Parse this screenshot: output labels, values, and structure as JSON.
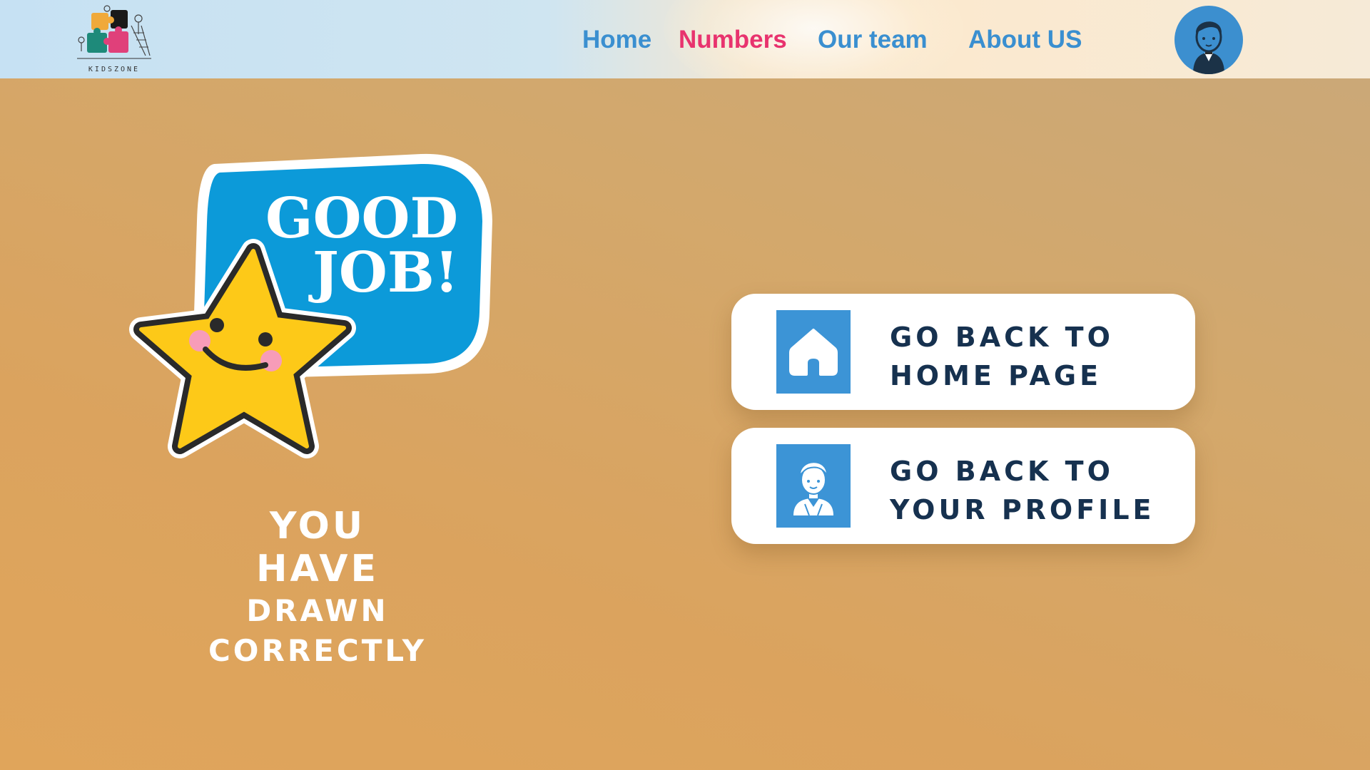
{
  "header": {
    "logo_text": "KIDSZONE",
    "nav": [
      {
        "label": "Home",
        "active": false
      },
      {
        "label": "Numbers",
        "active": true
      },
      {
        "label": "Our team",
        "active": false
      },
      {
        "label": "About US",
        "active": false
      }
    ],
    "avatar_icon": "boy-avatar-icon"
  },
  "sticker": {
    "line1": "GOOD",
    "line2": "JOB!",
    "icon": "smiling-star-icon"
  },
  "message": {
    "line1": "YOU",
    "line2": "HAVE",
    "line3": "DRAWN",
    "line4": "CORRECTLY"
  },
  "actions": {
    "home": {
      "line1": "GO BACK TO",
      "line2": "HOME PAGE",
      "icon": "home-icon"
    },
    "profile": {
      "line1": "GO BACK TO",
      "line2": "YOUR PROFILE",
      "icon": "profile-avatar-icon"
    }
  },
  "colors": {
    "nav_default": "#3a8fd0",
    "nav_active": "#e8336e",
    "bubble_blue": "#0c9ad9",
    "star_yellow": "#fdc918",
    "card_text": "#16314f",
    "icon_box": "#3c94d6"
  }
}
